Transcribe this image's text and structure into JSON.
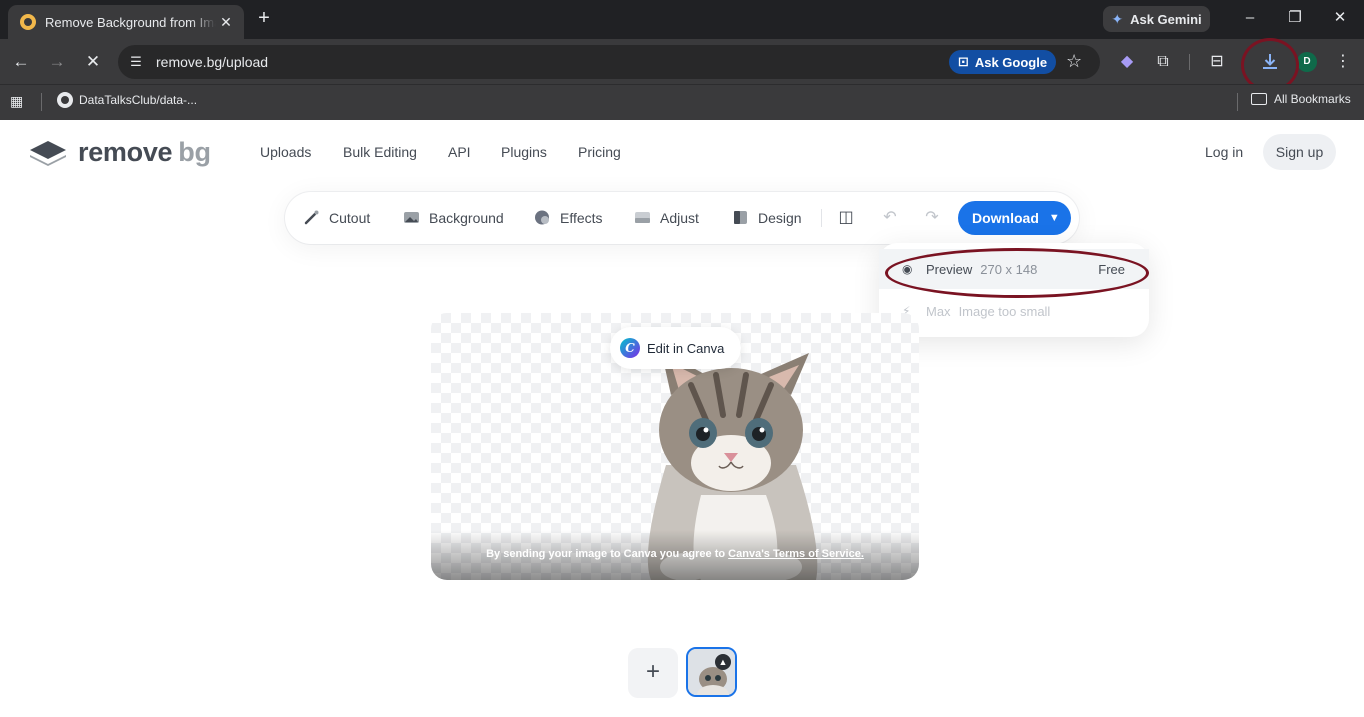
{
  "browser": {
    "tab_title": "Remove Background from Image",
    "ask_gemini": "Ask Gemini",
    "url": "remove.bg/upload",
    "ask_google": "Ask Google",
    "avatar_letter": "D",
    "bookmark": "DataTalksClub/data-...",
    "all_bookmarks": "All Bookmarks"
  },
  "site": {
    "logo_part1": "remove",
    "logo_part2": "bg",
    "nav": [
      "Uploads",
      "Bulk Editing",
      "API",
      "Plugins",
      "Pricing"
    ],
    "login": "Log in",
    "signup": "Sign up"
  },
  "editor": {
    "tools": [
      "Cutout",
      "Background",
      "Effects",
      "Adjust",
      "Design"
    ],
    "download": "Download",
    "edit_in_canva": "Edit in Canva",
    "tos_prefix": "By sending your image to Canva you agree to ",
    "tos_link": "Canva's Terms of Service."
  },
  "download_menu": {
    "preview_label": "Preview",
    "preview_size": "270 x 148",
    "preview_price": "Free",
    "max_label": "Max",
    "max_note": "Image too small"
  },
  "colors": {
    "accent_blue": "#1a73e8",
    "annotation_ring": "#7a1322",
    "browser_dark": "#202124"
  }
}
